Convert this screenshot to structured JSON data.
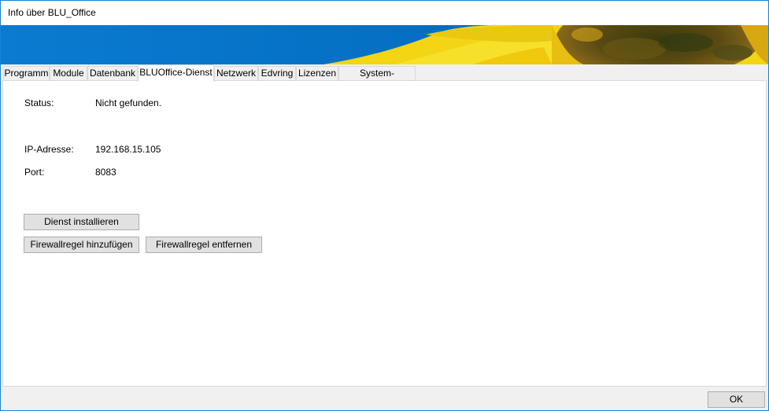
{
  "window": {
    "title": "Info über BLU_Office"
  },
  "tabs": [
    {
      "label": "Programm"
    },
    {
      "label": "Module"
    },
    {
      "label": "Datenbank"
    },
    {
      "label": "BLUOffice-Dienst"
    },
    {
      "label": "Netzwerk"
    },
    {
      "label": "Edvring"
    },
    {
      "label": "Lizenzen"
    },
    {
      "label": "System-Meldungen"
    }
  ],
  "active_tab": "BLUOffice-Dienst",
  "service": {
    "status_label": "Status:",
    "status_value": "Nicht gefunden.",
    "ip_label": "IP-Adresse:",
    "ip_value": "192.168.15.105",
    "port_label": "Port:",
    "port_value": "8083"
  },
  "buttons": {
    "install": "Dienst installieren",
    "add_firewall": "Firewallregel hinzufügen",
    "remove_firewall": "Firewallregel entfernen",
    "ok": "OK"
  },
  "colors": {
    "banner_blue": "#0774c8",
    "sunflower_yellow": "#f2d61c",
    "window_border": "#1883d7"
  }
}
